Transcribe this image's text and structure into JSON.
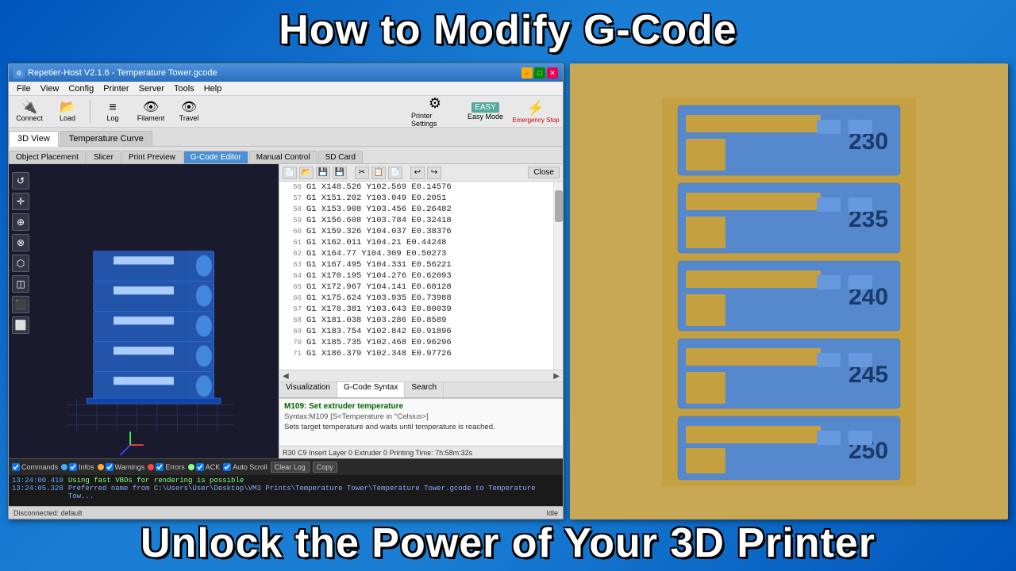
{
  "titles": {
    "top": "How to Modify G-Code",
    "bottom": "Unlock the Power of Your 3D Printer"
  },
  "window": {
    "title": "Repetier-Host V2.1.6 - Temperature Tower.gcode",
    "icon": "⚙"
  },
  "menu": {
    "items": [
      "File",
      "View",
      "Config",
      "Printer",
      "Server",
      "Tools",
      "Help"
    ]
  },
  "toolbar": {
    "connect_label": "Connect",
    "load_label": "Load",
    "log_label": "Log",
    "filament_label": "Filament",
    "travel_label": "Travel",
    "printer_settings_label": "Printer Settings",
    "easy_mode_label": "Easy Mode",
    "emergency_stop_label": "Emergency Stop"
  },
  "tabs": {
    "main": [
      "3D View",
      "Temperature Curve"
    ],
    "secondary": [
      "Object Placement",
      "Slicer",
      "Print Preview",
      "G-Code Editor",
      "Manual Control",
      "SD Card"
    ]
  },
  "gcode": {
    "toolbar_buttons": [
      "new",
      "open",
      "save",
      "save-as",
      "undo",
      "undo2",
      "redo",
      "close"
    ],
    "close_label": "Close",
    "lines": [
      {
        "num": "56",
        "code": "G1 X148.526 Y102.569 E0.14576"
      },
      {
        "num": "57",
        "code": "G1 X151.202 Y103.049 E0.2051"
      },
      {
        "num": "58",
        "code": "G1 X153.908 Y103.456 E0.26482"
      },
      {
        "num": "59",
        "code": "G1 X156.608 Y103.784 E0.32418"
      },
      {
        "num": "60",
        "code": "G1 X159.326 Y104.037 E0.38376"
      },
      {
        "num": "61",
        "code": "G1 X162.011 Y104.21 E0.44248"
      },
      {
        "num": "62",
        "code": "G1 X164.77 Y104.309 E0.50273"
      },
      {
        "num": "63",
        "code": "G1 X167.495 Y104.331 E0.56221"
      },
      {
        "num": "64",
        "code": "G1 X170.195 Y104.276 E0.62093"
      },
      {
        "num": "65",
        "code": "G1 X172.967 Y104.141 E0.68128"
      },
      {
        "num": "66",
        "code": "G1 X175.624 Y103.935 E0.73988"
      },
      {
        "num": "67",
        "code": "G1 X178.381 Y103.643 E0.80039"
      },
      {
        "num": "68",
        "code": "G1 X181.038 Y103.286 E0.8589"
      },
      {
        "num": "69",
        "code": "G1 X183.754 Y102.842 E0.91896"
      },
      {
        "num": "70",
        "code": "G1 X185.735 Y102.468 E0.96296"
      },
      {
        "num": "71",
        "code": "G1 X186.379 Y102.348 E0.97726"
      }
    ],
    "status": "R30  C9  Insert  Layer 0  Extruder 0  Printing Time: 7h:58m:32s"
  },
  "viz_tabs": [
    "Visualization",
    "G-Code Syntax",
    "Search"
  ],
  "syntax_help": {
    "command": "M109: Set extruder temperature",
    "syntax": "Syntax:M109 [S<Temperature in °Celsius>]",
    "description": "Sets target temperature and waits until temperature is reached."
  },
  "log": {
    "buttons": [
      "Commands",
      "Infos",
      "Warnings",
      "Errors",
      "ACK",
      "Auto Scroll",
      "Clear Log",
      "Copy"
    ],
    "lines": [
      {
        "time": "13:24:00.410",
        "msg": "Using fast VBOs for rendering is possible"
      },
      {
        "time": "13:24:05.328",
        "msg": "Preferred name from C:\\Users\\User\\Desktop\\VM3 Prints\\Temperature Tower\\Temperature Tower.gcode to Temperature Tow..."
      }
    ]
  },
  "status_bar": {
    "left": "Disconnected: default",
    "right": "Idle"
  },
  "photo": {
    "temperatures": [
      "230",
      "235",
      "240",
      "245",
      "250"
    ]
  }
}
